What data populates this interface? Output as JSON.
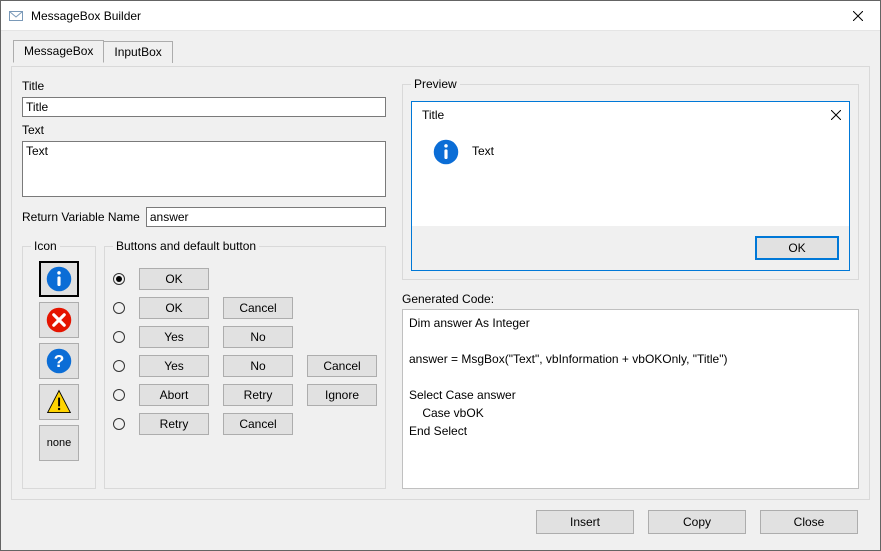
{
  "window": {
    "title": "MessageBox Builder",
    "close_icon": "✕"
  },
  "tabs": {
    "messagebox": "MessageBox",
    "inputbox": "InputBox"
  },
  "left": {
    "title_label": "Title",
    "title_value": "Title",
    "text_label": "Text",
    "text_value": "Text",
    "return_var_label": "Return Variable Name",
    "return_var_value": "answer"
  },
  "icon_fs": {
    "legend": "Icon",
    "none_label": "none"
  },
  "buttons_fs": {
    "legend": "Buttons and default button",
    "labels": {
      "ok": "OK",
      "cancel": "Cancel",
      "yes": "Yes",
      "no": "No",
      "abort": "Abort",
      "retry": "Retry",
      "ignore": "Ignore"
    }
  },
  "preview": {
    "legend": "Preview",
    "title": "Title",
    "text": "Text",
    "ok_label": "OK",
    "close_icon": "✕"
  },
  "gencode": {
    "label": "Generated Code:",
    "text": "Dim answer As Integer\n\nanswer = MsgBox(\"Text\", vbInformation + vbOKOnly, \"Title\")\n\nSelect Case answer\n    Case vbOK\nEnd Select"
  },
  "dialog_buttons": {
    "insert": "Insert",
    "copy": "Copy",
    "close": "Close"
  }
}
